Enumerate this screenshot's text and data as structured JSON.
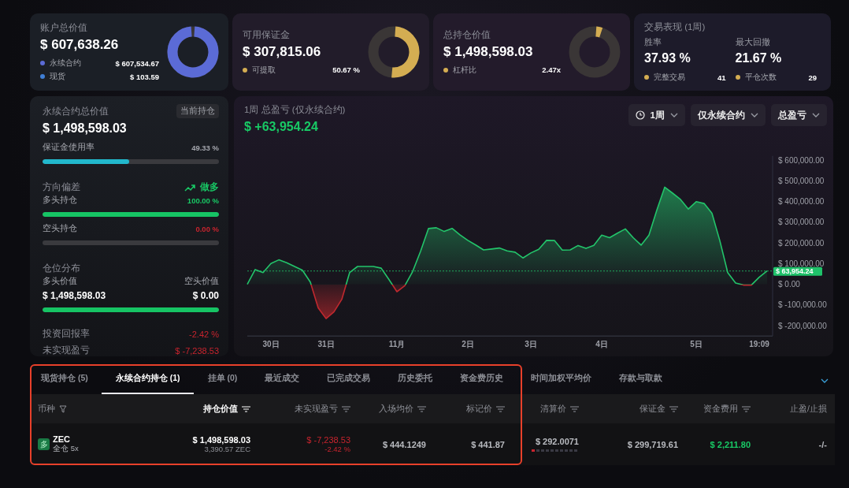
{
  "highlight_frame": true,
  "summary_cards": [
    {
      "kind": "donut",
      "title": "账户总价值",
      "value": "$ 607,638.26",
      "legend": [
        {
          "label": "永续合约",
          "value": "$ 607,534.67",
          "color": "#5b6bd6"
        },
        {
          "label": "现货",
          "value": "$ 103.59",
          "color": "#3f7fd6"
        }
      ]
    },
    {
      "kind": "donut",
      "title": "可用保证金",
      "value": "$ 307,815.06",
      "legend": [
        {
          "label": "可提取",
          "value": "50.67 %",
          "color": "#d4ad52"
        }
      ]
    },
    {
      "kind": "donut",
      "title": "总持仓价值",
      "value": "$ 1,498,598.03",
      "legend": [
        {
          "label": "杠杆比",
          "value": "2.47x",
          "color": "#d4ad52"
        }
      ]
    },
    {
      "kind": "stats",
      "title": "交易表现 (1周)",
      "metrics": [
        {
          "label": "胜率",
          "value": "37.93 %",
          "footer_label": "完整交易",
          "footer_value": "41"
        },
        {
          "label": "最大回撤",
          "value": "21.67 %",
          "footer_label": "平仓次数",
          "footer_value": "29"
        }
      ]
    }
  ],
  "perp_panel": {
    "title": "永续合约总价值",
    "badge": "当前持仓",
    "value": "$ 1,498,598.03",
    "margin_usage": {
      "label": "保证金使用率",
      "reading": "49.33 %",
      "level": 0.4933
    },
    "bias": {
      "title": "方向偏差",
      "direction": "做多"
    },
    "long": {
      "label": "多头持仓",
      "reading": "100.00 %",
      "level": 1
    },
    "short": {
      "label": "空头持仓",
      "reading": "0.00 %",
      "level": 0
    },
    "distribution": {
      "title": "仓位分布",
      "long_label": "多头价值",
      "short_label": "空头价值",
      "long_value": "$ 1,498,598.03",
      "short_value": "$ 0.00",
      "level": 1
    },
    "roi": {
      "label": "投资回报率",
      "value": "-2.42 %"
    },
    "unrealized_pnl": {
      "label": "未实现盈亏",
      "value": "$ -7,238.53"
    }
  },
  "pnl_chart": {
    "title": "1周 总盈亏 (仅永续合约)",
    "value": "$ +63,954.24",
    "filters": [
      {
        "label": "1周",
        "kind": "period"
      },
      {
        "label": "仅永续合约",
        "kind": "select"
      },
      {
        "label": "总盈亏",
        "kind": "select"
      }
    ],
    "chart_data": {
      "type": "area",
      "categories": [
        null,
        null,
        null,
        "30日",
        null,
        null,
        null,
        null,
        null,
        null,
        "31日",
        null,
        null,
        null,
        null,
        null,
        null,
        null,
        null,
        "11月",
        null,
        null,
        null,
        null,
        null,
        null,
        null,
        null,
        "2日",
        null,
        null,
        null,
        null,
        null,
        null,
        null,
        "3日",
        null,
        null,
        null,
        null,
        null,
        null,
        null,
        null,
        "4日",
        null,
        null,
        null,
        null,
        null,
        null,
        null,
        null,
        null,
        null,
        null,
        "5日",
        null,
        null,
        null,
        null,
        null,
        null,
        null,
        "19:09",
        null
      ],
      "values": [
        0,
        71000,
        56000,
        100000,
        118000,
        104000,
        86000,
        68000,
        11000,
        -114000,
        -166000,
        -134000,
        -73000,
        57000,
        86000,
        86000,
        86000,
        78000,
        22000,
        -36000,
        -7000,
        62000,
        159000,
        269000,
        273000,
        255000,
        270000,
        239000,
        212000,
        190000,
        166000,
        170000,
        175000,
        161000,
        155000,
        127000,
        151000,
        169000,
        212000,
        211000,
        165000,
        166000,
        187000,
        173000,
        188000,
        237000,
        225000,
        247000,
        267000,
        225000,
        189000,
        237000,
        358000,
        469000,
        440000,
        410000,
        363000,
        399000,
        390000,
        343000,
        210000,
        56000,
        6000,
        -4000,
        -4000,
        34000,
        64000
      ],
      "ylim": [
        -250000,
        620000
      ],
      "yticks": [
        {
          "value": 600000,
          "label": "$ 600,000.00"
        },
        {
          "value": 500000,
          "label": "$ 500,000.00"
        },
        {
          "value": 400000,
          "label": "$ 400,000.00"
        },
        {
          "value": 300000,
          "label": "$ 300,000.00"
        },
        {
          "value": 200000,
          "label": "$ 200,000.00"
        },
        {
          "value": 100000,
          "label": "$ 100,000.00"
        },
        {
          "value": 0,
          "label": "$ 0.00"
        },
        {
          "value": -100000,
          "label": "$ -100,000.00"
        },
        {
          "value": -200000,
          "label": "$ -200,000.00"
        }
      ],
      "ref_lines": [
        {
          "axis": "y",
          "value": 63954.24,
          "label": "$ 63,954.24"
        }
      ]
    }
  },
  "tabs": [
    {
      "label": "现货持仓 (5)",
      "selected": false
    },
    {
      "label": "永续合约持仓 (1)",
      "selected": true
    },
    {
      "label": "挂单 (0)",
      "selected": false
    },
    {
      "label": "最近成交",
      "selected": false
    },
    {
      "label": "已完成交易",
      "selected": false
    },
    {
      "label": "历史委托",
      "selected": false
    },
    {
      "label": "资金费历史",
      "selected": false
    },
    {
      "label": "时间加权平均价",
      "selected": false
    },
    {
      "label": "存款与取款",
      "selected": false
    }
  ],
  "table": {
    "columns": [
      {
        "label": "币种",
        "kind": "filter",
        "sorted": false
      },
      {
        "label": "持仓价值",
        "kind": "sort",
        "sorted": true
      },
      {
        "label": "未实现盈亏",
        "kind": "sort",
        "sorted": false
      },
      {
        "label": "入场均价",
        "kind": "sort",
        "sorted": false
      },
      {
        "label": "标记价",
        "kind": "sort",
        "sorted": false
      },
      {
        "label": "清算价",
        "kind": "sort",
        "sorted": false
      },
      {
        "label": "保证金",
        "kind": "sort",
        "sorted": false
      },
      {
        "label": "资金费用",
        "kind": "sort",
        "sorted": false
      },
      {
        "label": "止盈/止损",
        "kind": "plain",
        "sorted": false
      }
    ],
    "rows": [
      {
        "cells": [
          {
            "kind": "asset",
            "badge": "多",
            "symbol": "ZEC",
            "mode": "全仓 5x"
          },
          {
            "value": "$ 1,498,598.03",
            "sub": "3,390.57 ZEC"
          },
          {
            "value": "$ -7,238.53",
            "sub": "-2.42 %"
          },
          {
            "value": "$ 444.1249"
          },
          {
            "value": "$ 441.87"
          },
          {
            "value": "$ 292.0071",
            "level": 0.1
          },
          {
            "value": "$ 299,719.61"
          },
          {
            "value": "$ 2,211.80"
          },
          {
            "value": "-/-"
          }
        ]
      }
    ]
  }
}
